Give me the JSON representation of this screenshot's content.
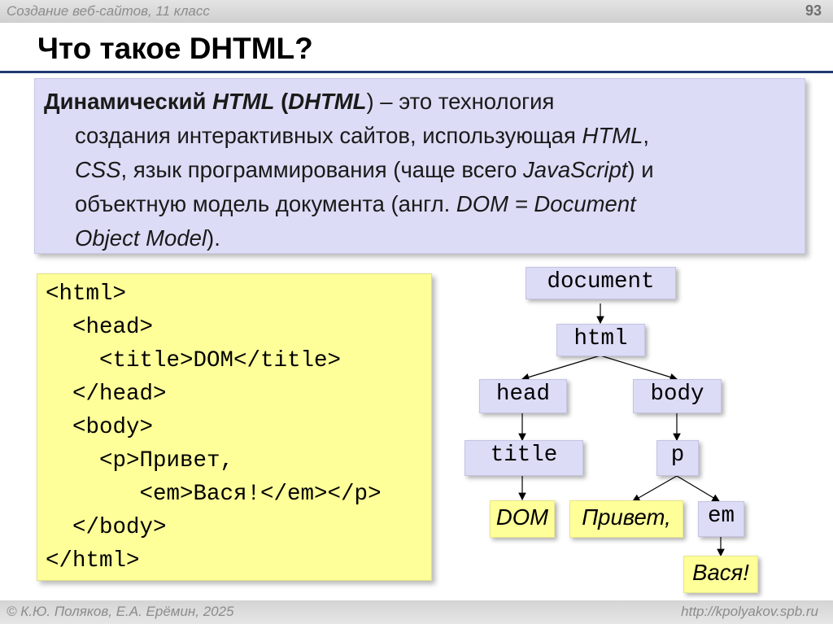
{
  "header": {
    "course": "Создание веб-сайтов, 11 класс",
    "page_number": "93"
  },
  "slide": {
    "title": "Что такое DHTML?"
  },
  "definition": {
    "term": "Динамический",
    "html1": "HTML",
    "open_paren": " (",
    "dhtml": "DHTML",
    "after_dhtml": ") – это технология",
    "line2_text": "создания интерактивных сайтов, использующая ",
    "html2": "HTML",
    "comma": ",",
    "css": "CSS",
    "line3_text": ", язык программирования (чаще всего ",
    "javascript": "JavaScript",
    "line3_end": ") и",
    "line4_text": "объектную модель документа (англ. ",
    "dom_expansion_a": "DOM = Document",
    "dom_expansion_b": "Object Model",
    "line5_end": ")."
  },
  "code_lines": [
    "<html>",
    "  <head>",
    "    <title>DOM</title>",
    "  </head>",
    "  <body>",
    "    <p>Привет,",
    "       <em>Вася!</em></p>",
    "  </body>",
    "</html>"
  ],
  "tree": {
    "document": "document",
    "html": "html",
    "head": "head",
    "body": "body",
    "title": "title",
    "p": "p",
    "em": "em",
    "dom_text": "DOM",
    "privet_text": "Привет,",
    "vasya_text": "Вася!"
  },
  "colors": {
    "element_node": "#dcdcf6",
    "text_node": "#ffff99",
    "title_rule": "#1f3b73"
  },
  "footer": {
    "copyright": "© К.Ю. Поляков, Е.А. Ерёмин, 2025",
    "url": "http://kpolyakov.spb.ru"
  }
}
